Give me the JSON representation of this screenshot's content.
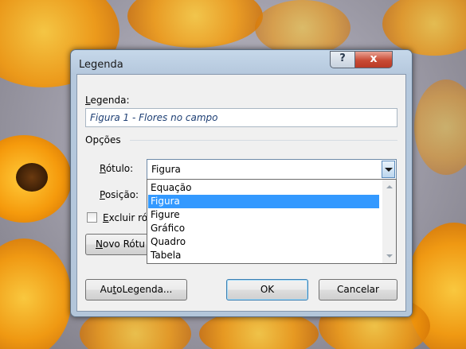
{
  "dialog": {
    "title": "Legenda",
    "help_label": "?",
    "close_label": "x",
    "caption_label": "Legenda:",
    "caption_value": "Figura 1 - Flores no campo",
    "options_label": "Opções",
    "rotulo_label": "Rótulo:",
    "rotulo_value": "Figura",
    "posicao_label": "Posição:",
    "excluir_label": "Excluir ró",
    "novo_rotulo_label": "Novo Rótu",
    "autolegenda_label": "AutoLegenda...",
    "ok_label": "OK",
    "cancel_label": "Cancelar"
  },
  "dropdown": {
    "items": [
      "Equação",
      "Figura",
      "Figure",
      "Gráfico",
      "Quadro",
      "Tabela"
    ],
    "selected": "Figura"
  }
}
